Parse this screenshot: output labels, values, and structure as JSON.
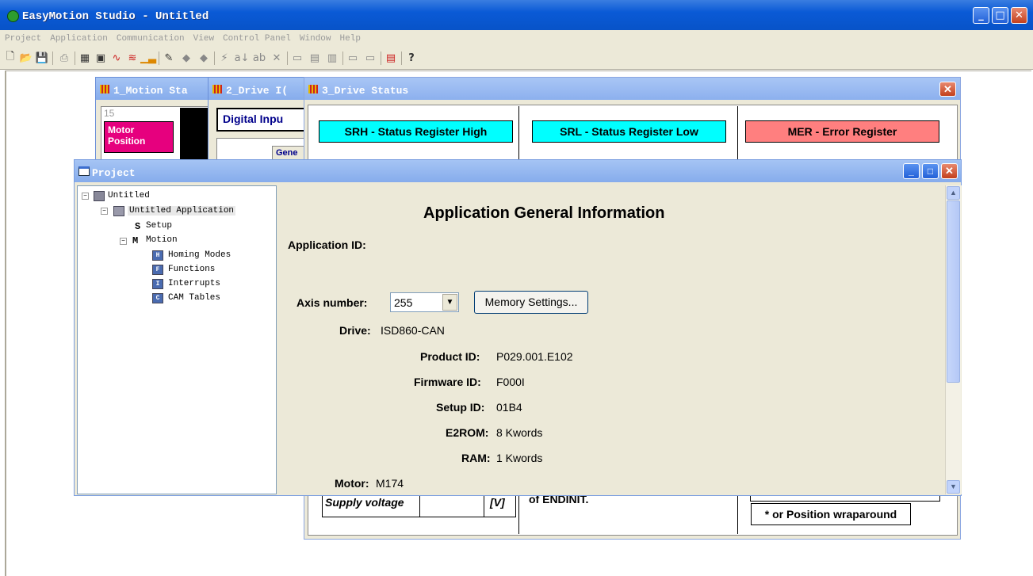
{
  "app": {
    "title": "EasyMotion Studio - Untitled"
  },
  "menu": [
    "Project",
    "Application",
    "Communication",
    "View",
    "Control Panel",
    "Window",
    "Help"
  ],
  "toolbar": {
    "icons": [
      "new-icon",
      "open-icon",
      "save-icon",
      "print-icon",
      "motion-status-icon",
      "drive-status-icon",
      "logger-icon",
      "scope-icon",
      "chart-icon",
      "setup-icon",
      "diamond-icon",
      "diamond2-icon",
      "run-icon",
      "sort-icon",
      "edit-icon",
      "delete-icon",
      "start-icon",
      "graph-icon",
      "graph2-icon",
      "start-stop-icon",
      "stop-icon",
      "communication-icon",
      "help-icon"
    ]
  },
  "windows": {
    "motion_status": {
      "title": "1_Motion Sta",
      "number": "15",
      "card": "Motor Position"
    },
    "drive_io": {
      "title": "2_Drive I(",
      "card": "Digital Inpu",
      "tab": "Gene"
    },
    "drive_status": {
      "title": "3_Drive Status",
      "cards": [
        "SRH - Status Register High",
        "SRL - Status Register Low",
        "MER - Error Register"
      ],
      "supply_label": "Supply voltage",
      "supply_unit": "[V]",
      "endinit_text": "of ENDINIT.",
      "wrap_text": "* or Position wraparound"
    },
    "project": {
      "title": "Project",
      "tree": {
        "root": "Untitled",
        "application": "Untitled Application",
        "setup": "Setup",
        "setup_icon_letter": "S",
        "motion": "Motion",
        "motion_icon_letter": "M",
        "homing": "Homing Modes",
        "functions": "Functions",
        "interrupts": "Interrupts",
        "cam_tables": "CAM Tables"
      },
      "info": {
        "heading": "Application General Information",
        "app_id_label": "Application ID:",
        "axis_label": "Axis number:",
        "axis_value": "255",
        "memory_button": "Memory Settings...",
        "drive_label": "Drive:",
        "drive_value": "ISD860-CAN",
        "product_label": "Product ID:",
        "product_value": "P029.001.E102",
        "firmware_label": "Firmware ID:",
        "firmware_value": "F000I",
        "setup_label": "Setup ID:",
        "setup_value": "01B4",
        "e2rom_label": "E2ROM:",
        "e2rom_value": "8 Kwords",
        "ram_label": "RAM:",
        "ram_value": "1 Kwords",
        "motor_label": "Motor:",
        "motor_value": "M174"
      }
    }
  }
}
